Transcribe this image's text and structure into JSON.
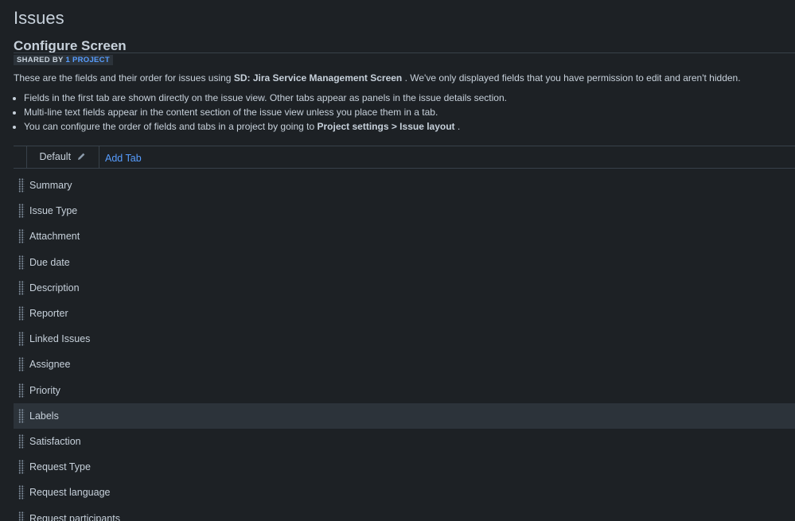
{
  "page": {
    "title": "Issues"
  },
  "screen": {
    "title": "Configure Screen",
    "shared_by_label": "SHARED BY",
    "shared_by_link": "1 PROJECT",
    "intro_prefix": "These are the fields and their order for issues using",
    "intro_screen_name": "SD: Jira Service Management Screen",
    "intro_suffix": ". We've only displayed fields that you have permission to edit and aren't hidden.",
    "bullets": [
      "Fields in the first tab are shown directly on the issue view. Other tabs appear as panels in the issue details section.",
      "Multi-line text fields appear in the content section of the issue view unless you place them in a tab."
    ],
    "bullet_three_prefix": "You can configure the order of fields and tabs in a project by going to",
    "bullet_three_bold": "Project settings > Issue layout",
    "bullet_three_suffix": "."
  },
  "tabs": {
    "default_label": "Default",
    "add_tab_label": "Add Tab"
  },
  "fields": [
    {
      "name": "Summary"
    },
    {
      "name": "Issue Type"
    },
    {
      "name": "Attachment"
    },
    {
      "name": "Due date"
    },
    {
      "name": "Description"
    },
    {
      "name": "Reporter"
    },
    {
      "name": "Linked Issues"
    },
    {
      "name": "Assignee"
    },
    {
      "name": "Priority"
    },
    {
      "name": "Labels",
      "highlighted": true
    },
    {
      "name": "Satisfaction"
    },
    {
      "name": "Request Type"
    },
    {
      "name": "Request language"
    },
    {
      "name": "Request participants"
    }
  ],
  "colors": {
    "background": "#1d2125",
    "text": "#c7d1db",
    "link": "#579dff",
    "badge_bg": "#2c333a",
    "row_highlight": "#2c333a",
    "divider": "#38414a"
  }
}
